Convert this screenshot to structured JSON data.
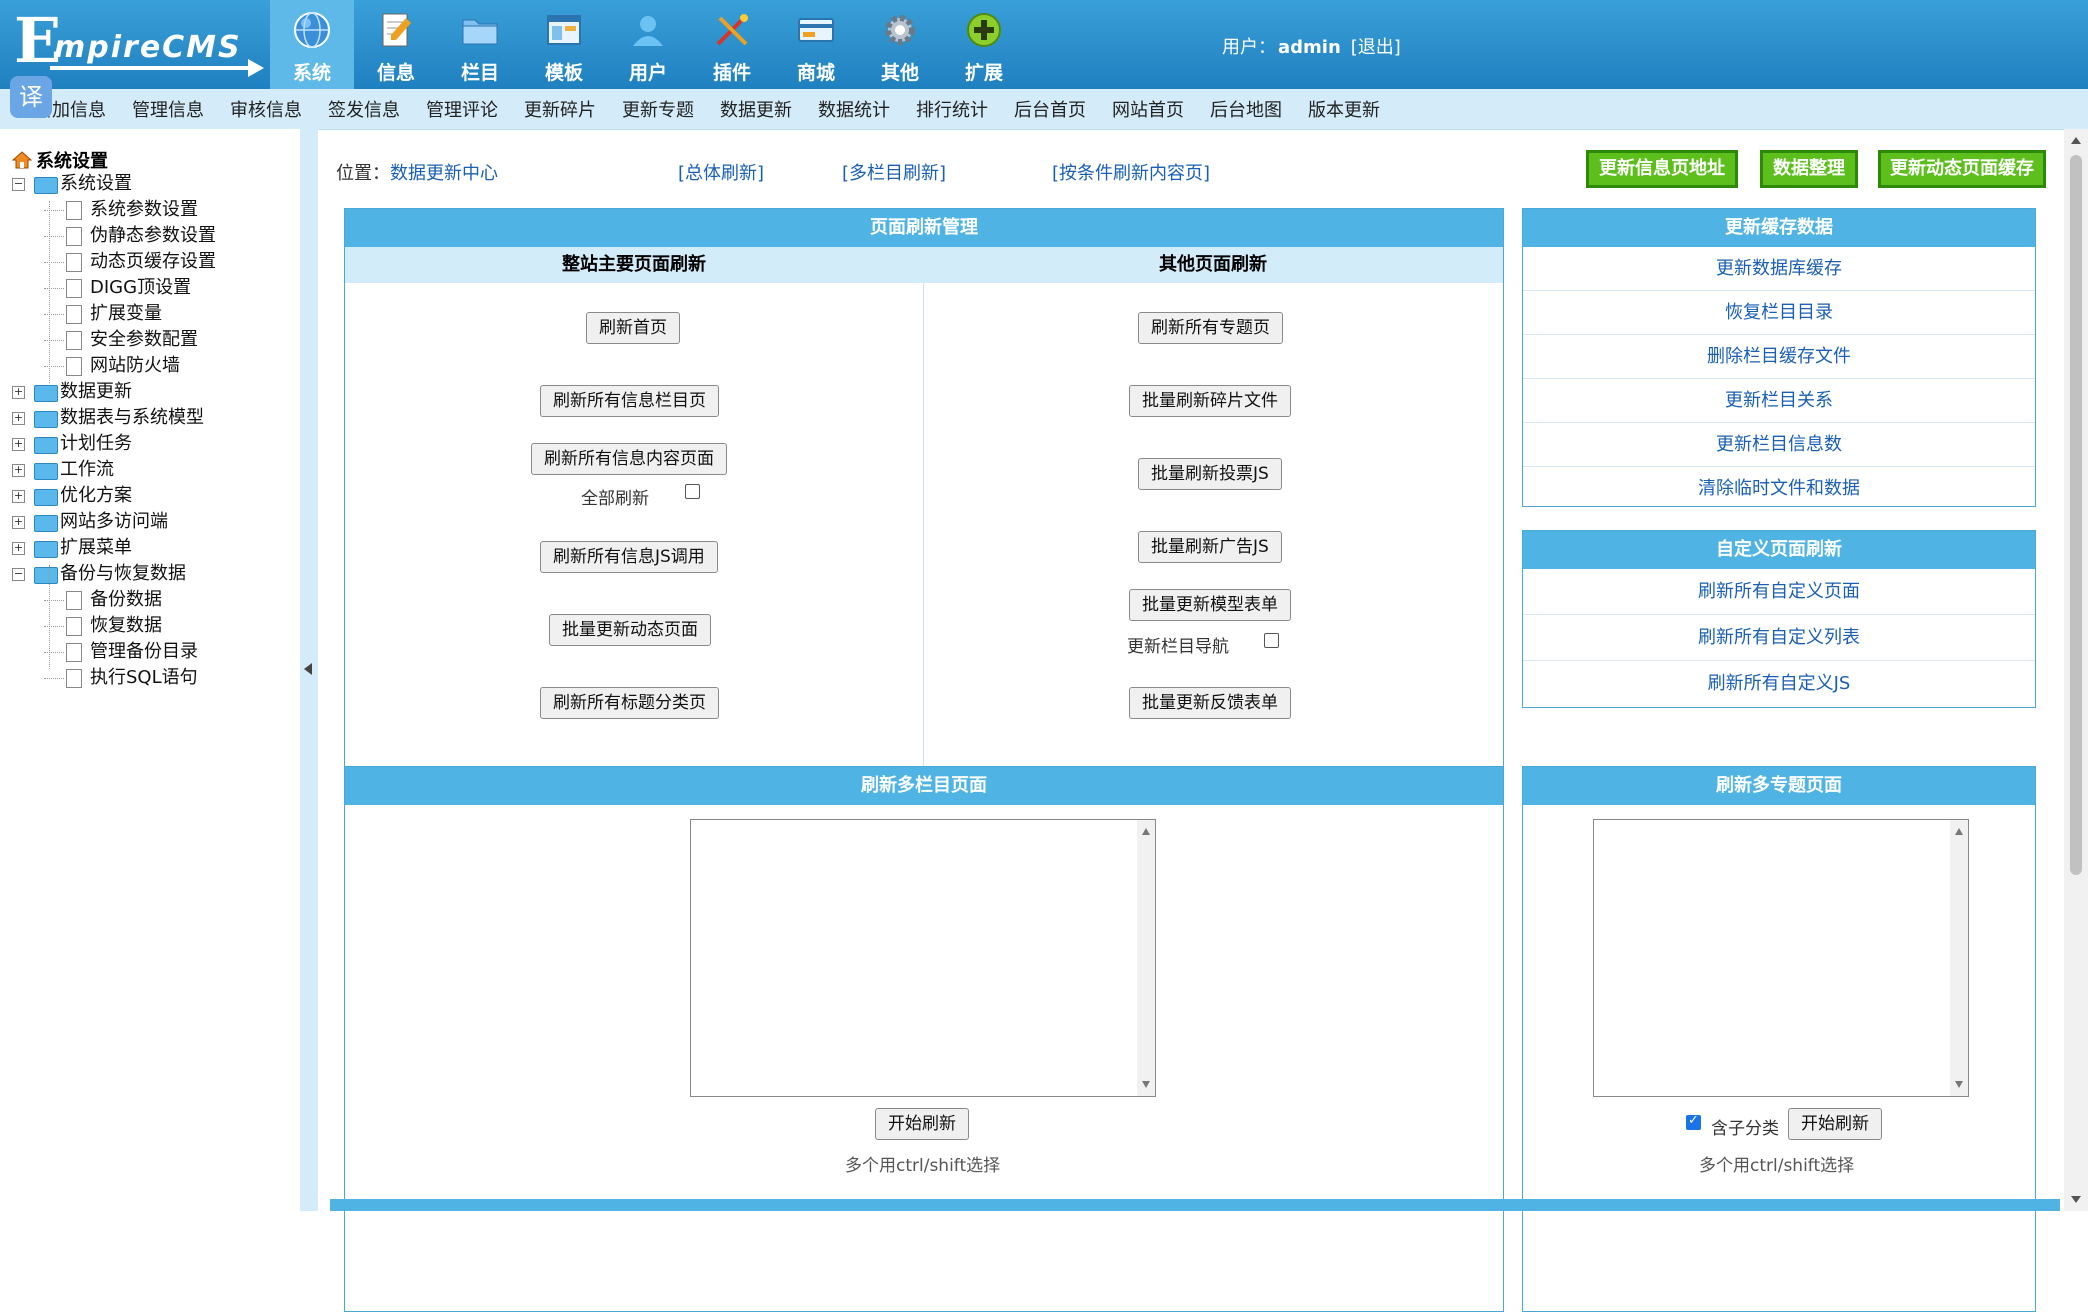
{
  "header": {
    "logo_text": "EmpireCMS",
    "logo_first": "E",
    "logo_rest": "mpireCMS",
    "translate_badge": "译",
    "nav": [
      {
        "label": "系统",
        "icon": "globe-icon",
        "active": true
      },
      {
        "label": "信息",
        "icon": "document-pencil-icon",
        "active": false
      },
      {
        "label": "栏目",
        "icon": "folder-icon",
        "active": false
      },
      {
        "label": "模板",
        "icon": "window-template-icon",
        "active": false
      },
      {
        "label": "用户",
        "icon": "user-icon",
        "active": false
      },
      {
        "label": "插件",
        "icon": "tools-icon",
        "active": false
      },
      {
        "label": "商城",
        "icon": "card-icon",
        "active": false
      },
      {
        "label": "其他",
        "icon": "gear-icon",
        "active": false
      },
      {
        "label": "扩展",
        "icon": "plus-circle-icon",
        "active": false
      }
    ],
    "user_label": "用户：",
    "user_name": "admin",
    "logout": "[退出]"
  },
  "subnav": [
    "增加信息",
    "管理信息",
    "审核信息",
    "签发信息",
    "管理评论",
    "更新碎片",
    "更新专题",
    "数据更新",
    "数据统计",
    "排行统计",
    "后台首页",
    "网站首页",
    "后台地图",
    "版本更新"
  ],
  "sidebar": {
    "root": "系统设置",
    "tree": [
      {
        "label": "系统设置",
        "type": "folder",
        "expanded": true,
        "children": [
          "系统参数设置",
          "伪静态参数设置",
          "动态页缓存设置",
          "DIGG顶设置",
          "扩展变量",
          "安全参数配置",
          "网站防火墙"
        ]
      },
      {
        "label": "数据更新",
        "type": "folder",
        "expanded": false
      },
      {
        "label": "数据表与系统模型",
        "type": "folder",
        "expanded": false
      },
      {
        "label": "计划任务",
        "type": "folder",
        "expanded": false
      },
      {
        "label": "工作流",
        "type": "folder",
        "expanded": false
      },
      {
        "label": "优化方案",
        "type": "folder",
        "expanded": false
      },
      {
        "label": "网站多访问端",
        "type": "folder",
        "expanded": false
      },
      {
        "label": "扩展菜单",
        "type": "folder",
        "expanded": false
      },
      {
        "label": "备份与恢复数据",
        "type": "folder",
        "expanded": true,
        "children": [
          "备份数据",
          "恢复数据",
          "管理备份目录",
          "执行SQL语句"
        ]
      }
    ]
  },
  "main": {
    "location_label": "位置：",
    "location_link": "数据更新中心",
    "top_links": [
      "[总体刷新]",
      "[多栏目刷新]",
      "[按条件刷新内容页]"
    ],
    "top_buttons": [
      "更新信息页地址",
      "数据整理",
      "更新动态页面缓存"
    ],
    "refresh_panel": {
      "title": "页面刷新管理",
      "left_header": "整站主要页面刷新",
      "right_header": "其他页面刷新",
      "left_buttons": [
        "刷新首页",
        "刷新所有信息栏目页",
        "刷新所有信息内容页面",
        "刷新所有信息JS调用",
        "批量更新动态页面",
        "刷新所有标题分类页"
      ],
      "all_refresh_label": "全部刷新",
      "all_refresh_checked": false,
      "right_buttons": [
        "刷新所有专题页",
        "批量刷新碎片文件",
        "批量刷新投票JS",
        "批量刷新广告JS",
        "批量更新模型表单",
        "批量更新反馈表单"
      ],
      "update_nav_label": "更新栏目导航",
      "update_nav_checked": false
    },
    "cache_panel": {
      "title": "更新缓存数据",
      "items": [
        "更新数据库缓存",
        "恢复栏目目录",
        "删除栏目缓存文件",
        "更新栏目关系",
        "更新栏目信息数",
        "清除临时文件和数据"
      ]
    },
    "custom_panel": {
      "title": "自定义页面刷新",
      "items": [
        "刷新所有自定义页面",
        "刷新所有自定义列表",
        "刷新所有自定义JS"
      ]
    },
    "multi_column_panel": {
      "title": "刷新多栏目页面",
      "start_button": "开始刷新",
      "hint": "多个用ctrl/shift选择"
    },
    "multi_topic_panel": {
      "title": "刷新多专题页面",
      "include_sub_label": "含子分类",
      "include_sub_checked": true,
      "start_button": "开始刷新",
      "hint": "多个用ctrl/shift选择"
    }
  }
}
